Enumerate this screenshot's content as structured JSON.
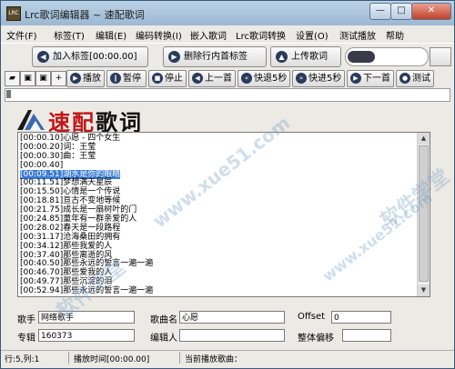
{
  "window": {
    "title": "Lrc歌词编辑器 ~ 速配歌词",
    "icon_text": "LRC"
  },
  "window_controls": {
    "minimize": "—",
    "maximize": "□",
    "close": "✕"
  },
  "menu": [
    "文件(F)",
    "标签(T)",
    "编辑(E)",
    "编码转换(I)",
    "嵌入歌词",
    "Lrc歌词转换",
    "设置(O)",
    "测试播放",
    "帮助"
  ],
  "toolbar": {
    "add_tag": "加入标签[00:00.00]",
    "remove_tag": "删除行内首标签",
    "upload": "上传歌词"
  },
  "player": {
    "play": "播放",
    "pause": "暂停",
    "stop": "停止",
    "prev": "上一首",
    "rewind": "快退5秒",
    "forward": "快进5秒",
    "next": "下一首",
    "test": "测试"
  },
  "logo": {
    "red": "速配",
    "black": "歌词"
  },
  "lyrics": {
    "lines": [
      "[00:00.10]心愿 - 四个女生",
      "[00:00.20]词：王莹",
      "[00:00.30]曲：王莹",
      "[00:00.40]",
      "[00:09.51]湖水是你的眼睛",
      "[00:11.51]梦想满天星辰",
      "[00:15.50]心情是一个传说",
      "[00:18.81]亘古不变地等候",
      "[00:21.75]成长是一扇树叶的门",
      "[00:24.85]童年有一群亲爱的人",
      "[00:28.02]春天是一段路程",
      "[00:31.17]沧海桑田的拥有",
      "[00:34.12]那些我爱的人",
      "[00:37.40]那些离逝的风",
      "[00:40.50]那些永远的誓言一遍一遍",
      "[00:46.70]那些爱我的人",
      "[00:49.77]那些沉淀的泪",
      "[00:52.94]那些永远的誓言一遍一遍"
    ],
    "selected_index": 4
  },
  "form": {
    "singer_label": "歌手",
    "singer_value": "网络歌手",
    "song_label": "歌曲名",
    "song_value": "心愿",
    "offset_label": "Offset",
    "offset_value": "0",
    "album_label": "专辑",
    "album_value": "160373",
    "editor_label": "编辑人",
    "editor_value": "",
    "overall_offset_label": "整体偏移",
    "overall_offset_value": ""
  },
  "status": {
    "cursor": "行:5,列:1",
    "play_time": "播放时间[00:00.00]",
    "current_song": "当前播放歌曲："
  },
  "watermarks": [
    "软件学堂",
    "www.xue51.com"
  ]
}
